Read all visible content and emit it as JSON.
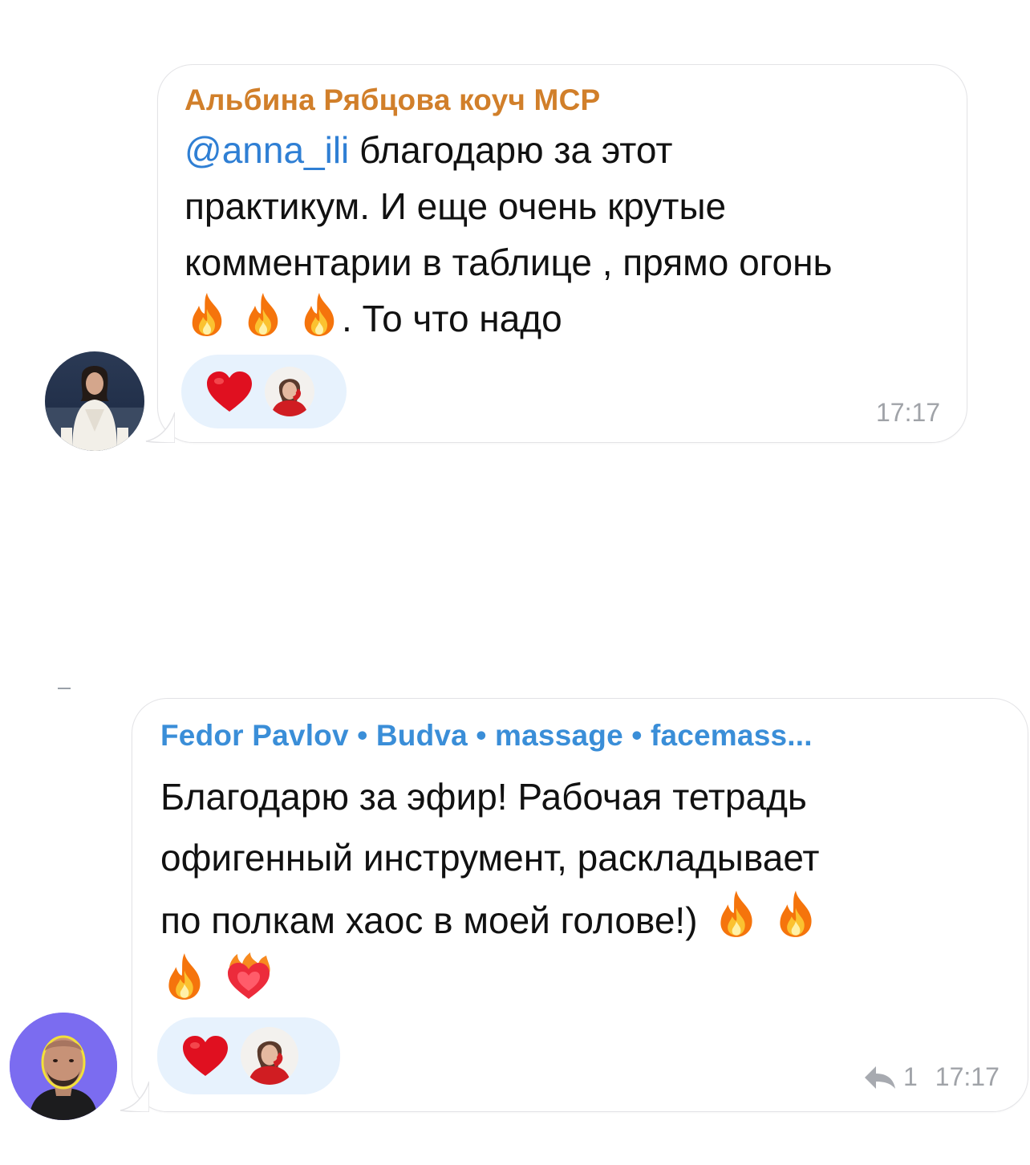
{
  "messages": [
    {
      "sender": "Альбина Рябцова коуч МСР",
      "sender_color": "#d17f2a",
      "mention": "@anna_ili",
      "text_line1_rest": " благодарю за этот",
      "text_line2": "практикум. И еще очень крутые",
      "text_line3": "комментарии в таблице , прямо огонь",
      "text_line4_rest": ". То что надо",
      "time": "17:17",
      "avatar_icon": "woman-portrait-avatar",
      "reactions": {
        "emoji": "red-heart",
        "reactor_icon": "reactor-woman-avatar"
      }
    },
    {
      "sender": "Fedor Pavlov • Budva • massage • facemass...",
      "sender_color": "#3a8ed8",
      "text_line1": "Благодарю за эфир! Рабочая тетрадь",
      "text_line2": "офигенный инструмент, раскладывает",
      "text_line3": "по полкам хаос в моей голове!)",
      "time": "17:17",
      "reply_count": "1",
      "avatar_icon": "man-portrait-avatar",
      "avatar_bg": "#7b6cf0",
      "reactions": {
        "emoji": "red-heart",
        "reactor_icon": "reactor-woman-avatar"
      }
    }
  ],
  "colors": {
    "bubble_border": "#e3e3e6",
    "reaction_bg": "#e7f2fd",
    "mention": "#2f7fd4",
    "time": "#a0a3a8"
  }
}
